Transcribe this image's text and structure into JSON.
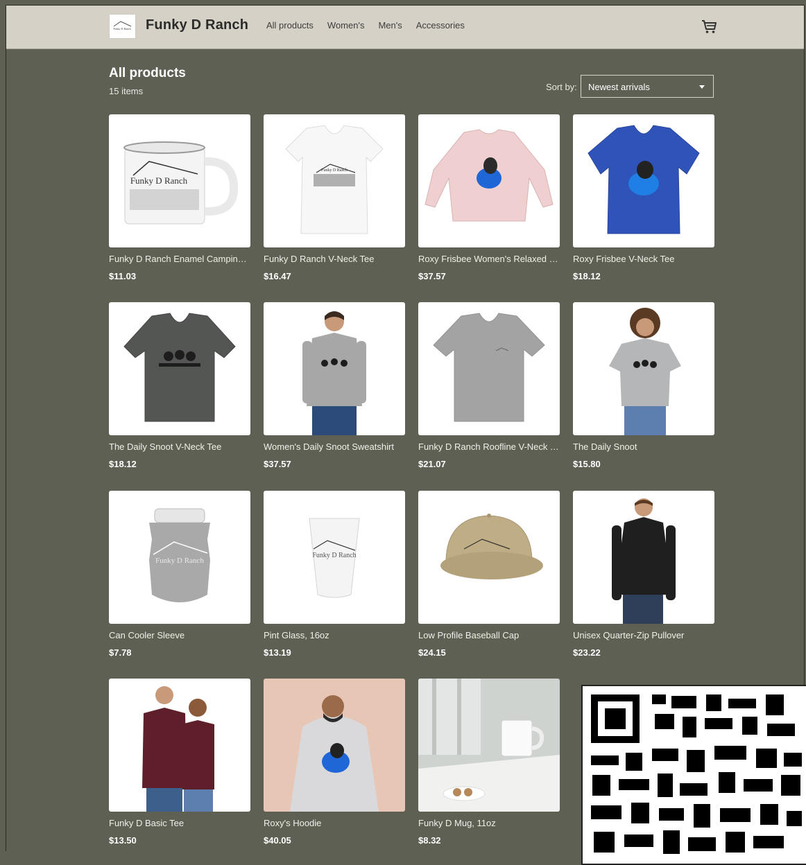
{
  "header": {
    "brand": "Funky D Ranch",
    "logo_text": "Funky D Ranch",
    "nav": [
      "All products",
      "Women's",
      "Men's",
      "Accessories"
    ],
    "cart_icon": "shopping-cart-icon"
  },
  "listing": {
    "title": "All products",
    "count": "15 items",
    "sort_label": "Sort by:",
    "sort_value": "Newest arrivals"
  },
  "products": [
    {
      "name": "Funky D Ranch Enamel Camping ...",
      "price": "$11.03",
      "image": "enamel-mug"
    },
    {
      "name": "Funky D Ranch V-Neck Tee",
      "price": "$16.47",
      "image": "white-vneck-tee"
    },
    {
      "name": "Roxy Frisbee Women's Relaxed Fi...",
      "price": "$37.57",
      "image": "pink-sweatshirt"
    },
    {
      "name": "Roxy Frisbee V-Neck Tee",
      "price": "$18.12",
      "image": "blue-vneck-tee"
    },
    {
      "name": "The Daily Snoot V-Neck Tee",
      "price": "$18.12",
      "image": "dark-gray-vneck-tee"
    },
    {
      "name": "Women's Daily Snoot Sweatshirt",
      "price": "$37.57",
      "image": "woman-gray-sweatshirt"
    },
    {
      "name": "Funky D Ranch Roofline V-Neck T...",
      "price": "$21.07",
      "image": "gray-vneck-tee"
    },
    {
      "name": "The Daily Snoot",
      "price": "$15.80",
      "image": "woman-gray-tee"
    },
    {
      "name": "Can Cooler Sleeve",
      "price": "$7.78",
      "image": "can-cooler"
    },
    {
      "name": "Pint Glass, 16oz",
      "price": "$13.19",
      "image": "pint-glass"
    },
    {
      "name": "Low Profile Baseball Cap",
      "price": "$24.15",
      "image": "khaki-cap"
    },
    {
      "name": "Unisex Quarter-Zip Pullover",
      "price": "$23.22",
      "image": "man-black-pullover"
    },
    {
      "name": "Funky D Basic Tee",
      "price": "$13.50",
      "image": "couple-maroon-tees"
    },
    {
      "name": "Roxy's Hoodie",
      "price": "$40.05",
      "image": "man-gray-hoodie"
    },
    {
      "name": "Funky D Mug, 11oz",
      "price": "$8.32",
      "image": "white-mug-window"
    }
  ],
  "overlay": {
    "qr_code": "qr-code-image"
  }
}
